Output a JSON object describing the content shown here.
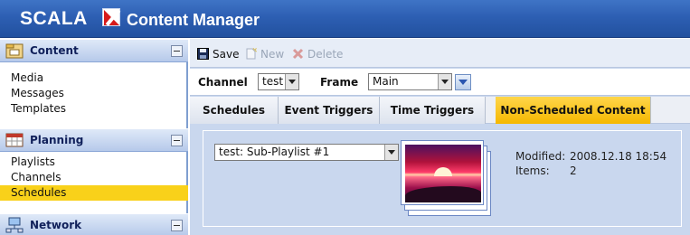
{
  "header": {
    "brand": "SCALA",
    "product": "Content Manager",
    "colors": {
      "bar": "#2d5fb3",
      "logo_red": "#d61a1a"
    }
  },
  "sidebar": {
    "sections": [
      {
        "title": "Content",
        "icon": "content-folder-icon",
        "items": [
          "Media",
          "Messages",
          "Templates"
        ]
      },
      {
        "title": "Planning",
        "icon": "planning-calendar-icon",
        "items": [
          "Playlists",
          "Channels",
          "Schedules"
        ],
        "active": "Schedules"
      },
      {
        "title": "Network",
        "icon": "network-computer-icon",
        "items": []
      }
    ],
    "active_color": "#f9d11a"
  },
  "toolbar": {
    "save_label": "Save",
    "new_label": "New",
    "delete_label": "Delete"
  },
  "selectors": {
    "channel_label": "Channel",
    "channel_value": "test",
    "frame_label": "Frame",
    "frame_value": "Main"
  },
  "tabs": {
    "items": [
      "Schedules",
      "Event Triggers",
      "Time Triggers",
      "Non-Scheduled Content"
    ],
    "active": "Non-Scheduled Content",
    "active_color": "#f5b800"
  },
  "content": {
    "playlist_value": "test: Sub-Playlist #1",
    "thumbnail_icon": "sunset-thumbnail-icon",
    "modified_label": "Modified:",
    "modified_value": "2008.12.18 18:54",
    "items_label": "Items:",
    "items_value": "2"
  }
}
